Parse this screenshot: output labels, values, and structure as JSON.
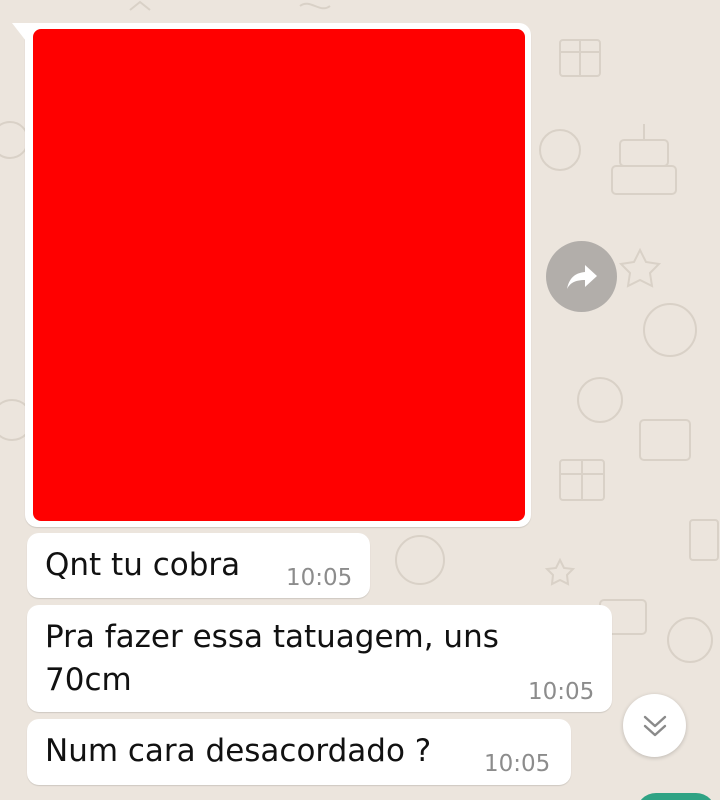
{
  "colors": {
    "wallpaper": "#ece5dd",
    "bubble": "#ffffff",
    "image_fill": "#ff0000",
    "timestamp": "#8c8c8c",
    "forward_button": "#b2aeaa",
    "accent": "#2fa384"
  },
  "icons": {
    "forward": "forward-arrow-icon",
    "scroll_down": "double-chevron-down-icon"
  },
  "messages": [
    {
      "type": "image",
      "image_description": "solid red square image",
      "direction": "incoming"
    },
    {
      "type": "text",
      "text": "Qnt tu cobra",
      "time": "10:05",
      "direction": "incoming"
    },
    {
      "type": "text",
      "text_lines": [
        "Pra fazer essa tatuagem, uns",
        "70cm"
      ],
      "time": "10:05",
      "direction": "incoming"
    },
    {
      "type": "text",
      "text": "Num cara desacordado ?",
      "time": "10:05",
      "direction": "incoming"
    }
  ]
}
